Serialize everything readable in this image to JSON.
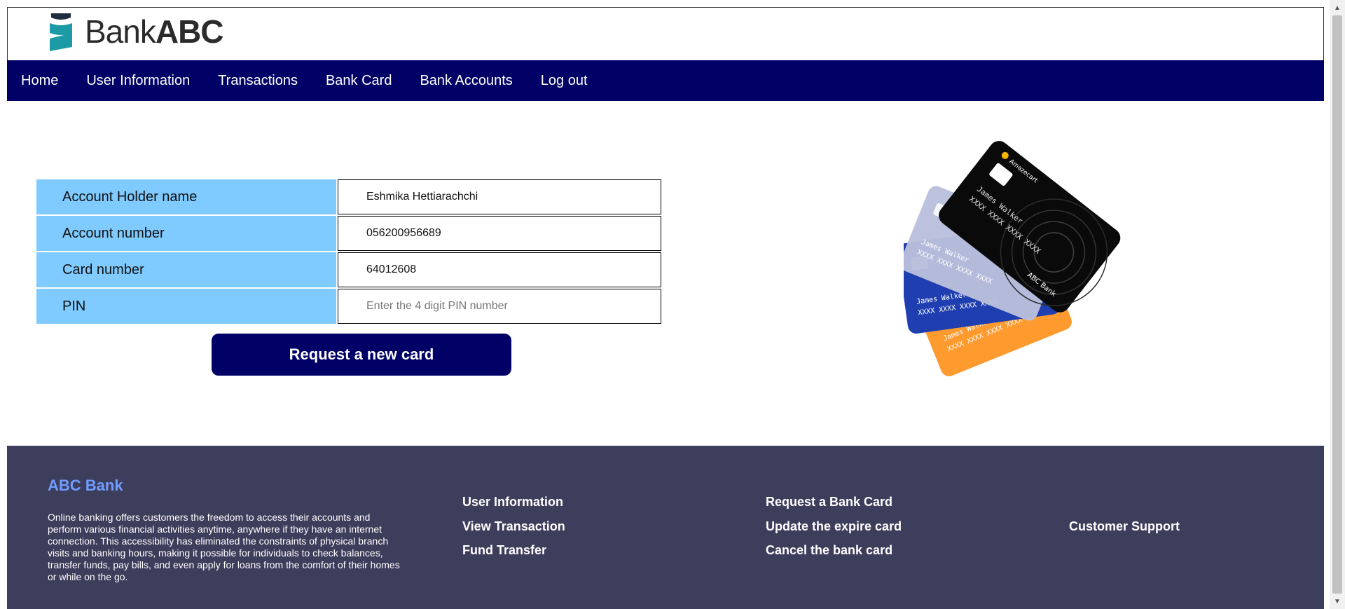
{
  "header": {
    "logo_light": "Bank",
    "logo_bold": "ABC"
  },
  "nav": {
    "items": [
      {
        "label": "Home"
      },
      {
        "label": "User Information"
      },
      {
        "label": "Transactions"
      },
      {
        "label": "Bank Card"
      },
      {
        "label": "Bank Accounts"
      },
      {
        "label": "Log out"
      }
    ]
  },
  "form": {
    "rows": [
      {
        "label": "Account Holder name",
        "value": "Eshmika Hettiarachchi",
        "placeholder": ""
      },
      {
        "label": "Account number",
        "value": "056200956689",
        "placeholder": ""
      },
      {
        "label": "Card number",
        "value": "64012608",
        "placeholder": ""
      },
      {
        "label": "PIN",
        "value": "",
        "placeholder": "Enter the 4 digit PIN number"
      }
    ],
    "submit_label": "Request a new card"
  },
  "illustration": {
    "card_holder": "James Walker",
    "card_number": "XXXX XXXX XXXX XXXX",
    "card_brand": "ABC Bank",
    "card_badge": "Amazecart"
  },
  "footer": {
    "brand": "ABC Bank",
    "description": "Online banking offers customers the freedom to access their accounts and perform various financial activities anytime, anywhere if they have an internet connection. This accessibility has eliminated the constraints of physical branch visits and banking hours, making it possible for individuals to check balances, transfer funds, pay bills, and even apply for loans from the comfort of their homes or while on the go.",
    "col1": [
      "User Information",
      "View Transaction",
      "Fund Transfer"
    ],
    "col2": [
      "Request a Bank Card",
      "Update the expire card",
      "Cancel the bank card"
    ],
    "col3": [
      "Customer Support"
    ]
  },
  "colors": {
    "nav_bg": "#000066",
    "label_bg": "#7fcaff",
    "footer_bg": "#3d3d5c",
    "footer_brand": "#6f9cff",
    "logo_teal": "#1c9aa5"
  }
}
